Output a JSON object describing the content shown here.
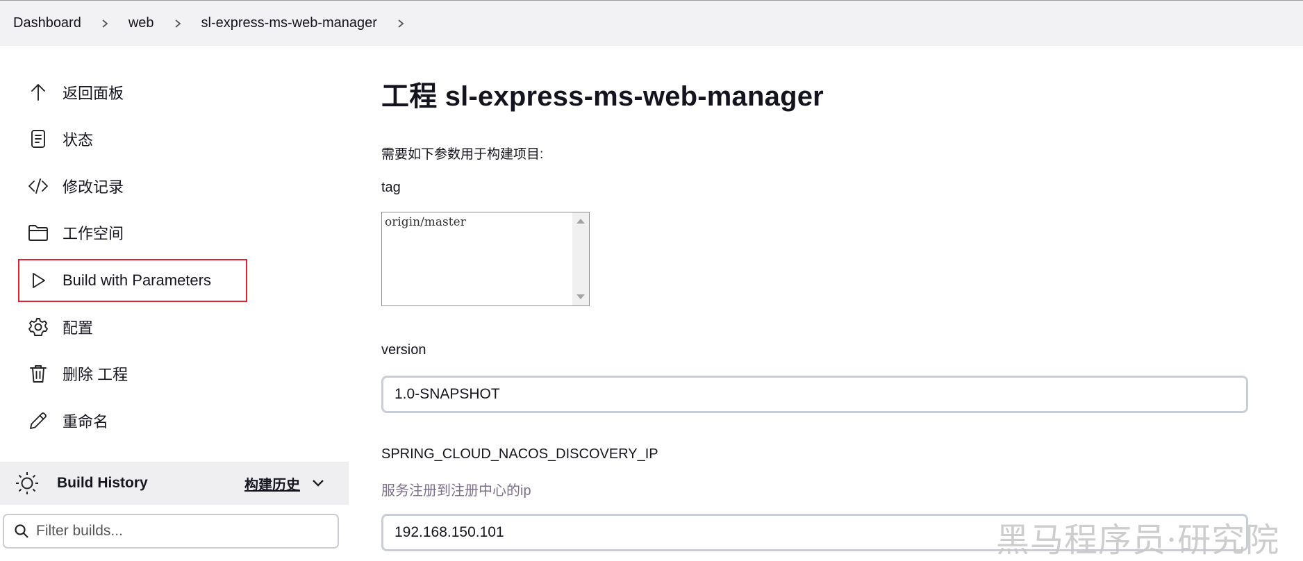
{
  "breadcrumb": {
    "items": [
      {
        "label": "Dashboard"
      },
      {
        "label": "web"
      },
      {
        "label": "sl-express-ms-web-manager"
      }
    ]
  },
  "sidebar": {
    "items": [
      {
        "label": "返回面板",
        "icon": "arrow-up-icon"
      },
      {
        "label": "状态",
        "icon": "document-icon"
      },
      {
        "label": "修改记录",
        "icon": "code-icon"
      },
      {
        "label": "工作空间",
        "icon": "folder-icon"
      },
      {
        "label": "Build with Parameters",
        "icon": "play-icon"
      },
      {
        "label": "配置",
        "icon": "gear-icon"
      },
      {
        "label": "删除 工程",
        "icon": "trash-icon"
      },
      {
        "label": "重命名",
        "icon": "pencil-icon"
      }
    ]
  },
  "build_history": {
    "title": "Build History",
    "title_cn": "构建历史",
    "filter_placeholder": "Filter builds..."
  },
  "main": {
    "title": "工程 sl-express-ms-web-manager",
    "description": "需要如下参数用于构建项目:",
    "params": [
      {
        "name": "tag",
        "value": "origin/master"
      },
      {
        "name": "version",
        "value": "1.0-SNAPSHOT"
      },
      {
        "name": "SPRING_CLOUD_NACOS_DISCOVERY_IP",
        "help": "服务注册到注册中心的ip",
        "value": "192.168.150.101"
      }
    ]
  },
  "watermark": "黑马程序员·研究院",
  "colors": {
    "highlight": "#e0232e",
    "breadcrumb_bg": "#f2f2f4",
    "help_text": "#7b6f8a"
  }
}
